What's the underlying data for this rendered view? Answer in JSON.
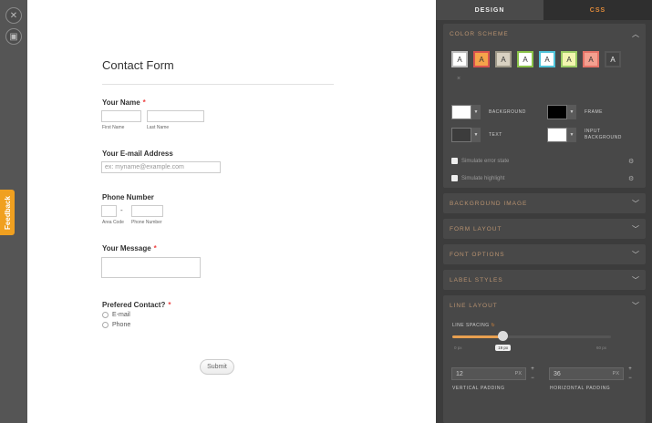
{
  "rail": {
    "close_icon": "close-icon",
    "save_icon": "save-icon",
    "feedback_label": "Feedback"
  },
  "form": {
    "title": "Contact Form",
    "name": {
      "label": "Your Name",
      "required": "*",
      "first": "First Name",
      "last": "Last Name"
    },
    "email": {
      "label": "Your E-mail Address",
      "placeholder": "ex: myname@example.com"
    },
    "phone": {
      "label": "Phone Number",
      "dash": "-",
      "area": "Area Code",
      "number": "Phone Number"
    },
    "message": {
      "label": "Your Message",
      "required": "*"
    },
    "contact": {
      "label": "Prefered Contact?",
      "required": "*",
      "options": [
        "E-mail",
        "Phone"
      ]
    },
    "submit_label": "Submit"
  },
  "panel": {
    "tabs": {
      "design": "DESIGN",
      "css": "CSS"
    },
    "color_scheme": {
      "title": "COLOR SCHEME",
      "swatches": [
        {
          "bg": "#ffffff",
          "border": "#bdbdbd",
          "text": "#333333",
          "letter": "A"
        },
        {
          "bg": "#f5a34a",
          "border": "#d9534f",
          "text": "#333333",
          "letter": "A"
        },
        {
          "bg": "#d9d2c2",
          "border": "#a09a8a",
          "text": "#333333",
          "letter": "A"
        },
        {
          "bg": "#ffffff",
          "border": "#8bc34a",
          "text": "#333333",
          "letter": "A"
        },
        {
          "bg": "#ffffff",
          "border": "#4fc3d9",
          "text": "#333333",
          "letter": "A"
        },
        {
          "bg": "#f3f5b0",
          "border": "#9ccc65",
          "text": "#333333",
          "letter": "A"
        },
        {
          "bg": "#f4a090",
          "border": "#e57368",
          "text": "#333333",
          "letter": "A"
        },
        {
          "bg": "#444444",
          "border": "#555555",
          "text": "#eeeeee",
          "letter": "A"
        }
      ],
      "reset_icon": "×"
    },
    "colors": {
      "background": {
        "label": "BACKGROUND",
        "value": "#ffffff"
      },
      "frame": {
        "label": "FRAME",
        "value": "#000000"
      },
      "text": {
        "label": "TEXT",
        "value": "#3c3c3c"
      },
      "input_bg": {
        "label": "INPUT BACKGROUND",
        "value": "#ffffff"
      },
      "arrow": "▼"
    },
    "sim_error": "Simulate error state",
    "sim_highlight": "Simulate highlight",
    "sections": [
      "BACKGROUND IMAGE",
      "FORM LAYOUT",
      "FONT OPTIONS",
      "LABEL STYLES"
    ],
    "line_layout": {
      "title": "LINE LAYOUT",
      "spacing_label": "LINE SPACING",
      "min": "0 px",
      "max": "60 px",
      "value_label": "19 px",
      "value": 19,
      "range": [
        0,
        60
      ],
      "vertical": {
        "value": "12",
        "unit": "PX",
        "label": "VERTICAL PADDING"
      },
      "horizontal": {
        "value": "36",
        "unit": "PX",
        "label": "HORIZONTAL PADDING"
      },
      "plus": "+",
      "minus": "−"
    }
  },
  "colors": {
    "accent": "#e8a050",
    "panel_bg": "#3c3c3c",
    "section_title": "#b89270"
  }
}
